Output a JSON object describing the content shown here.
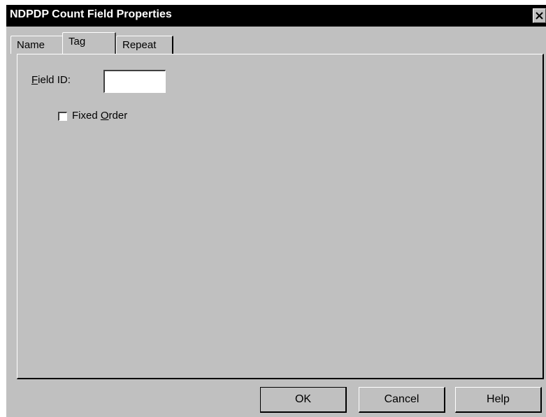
{
  "window": {
    "title": "NDPDP Count Field Properties",
    "close_icon": "close-icon"
  },
  "tabs": [
    {
      "label": "Name",
      "active": false
    },
    {
      "label": "Tag",
      "active": true
    },
    {
      "label": "Repeat",
      "active": false
    }
  ],
  "tag_panel": {
    "field_id": {
      "label_mnemonic": "F",
      "label_rest": "ield ID:",
      "value": ""
    },
    "fixed_order": {
      "label_prefix": "Fixed ",
      "label_mnemonic": "O",
      "label_rest": "rder",
      "checked": false
    }
  },
  "buttons": {
    "ok": "OK",
    "cancel": "Cancel",
    "help": "Help"
  },
  "colors": {
    "face": "#c0c0c0",
    "titlebar": "#000000",
    "title_text": "#ffffff"
  }
}
